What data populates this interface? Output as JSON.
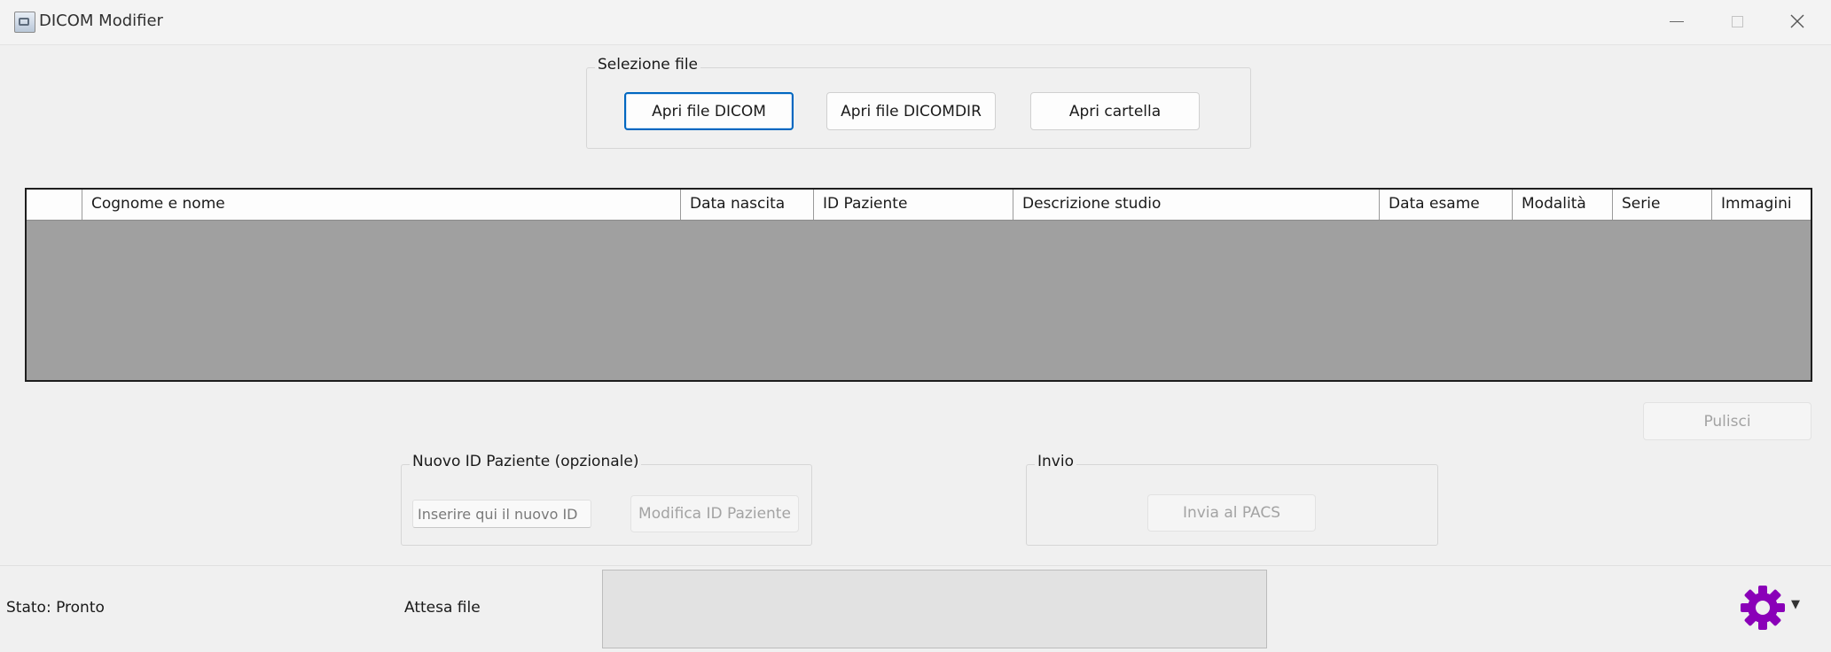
{
  "window": {
    "title": "DICOM Modifier"
  },
  "file_selection": {
    "legend": "Selezione file",
    "open_dicom": "Apri file DICOM",
    "open_dicomdir": "Apri file DICOMDIR",
    "open_folder": "Apri cartella"
  },
  "table": {
    "columns": [
      "",
      "Cognome e nome",
      "Data nascita",
      "ID Paziente",
      "Descrizione studio",
      "Data esame",
      "Modalità",
      "Serie",
      "Immagini"
    ],
    "rows": []
  },
  "clear_button": "Pulisci",
  "new_patient_id": {
    "legend": "Nuovo ID Paziente (opzionale)",
    "placeholder": "Inserire qui il nuovo ID",
    "modify_button": "Modifica ID Paziente"
  },
  "send": {
    "legend": "Invio",
    "send_button": "Invia al PACS"
  },
  "status": {
    "state": "Stato: Pronto",
    "waiting": "Attesa file"
  },
  "colors": {
    "accent": "#0067c0",
    "gear": "#8a00b8",
    "table_body": "#a0a0a0"
  },
  "icons": [
    "app-icon",
    "minimize-icon",
    "maximize-icon",
    "close-icon",
    "gear-icon",
    "chevron-down-icon"
  ]
}
